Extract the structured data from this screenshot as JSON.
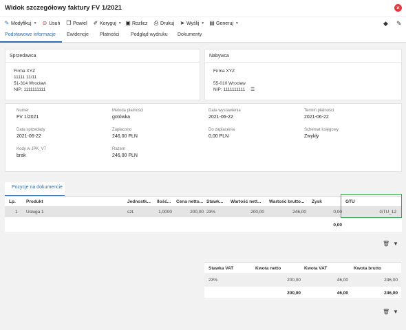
{
  "window": {
    "title": "Widok szczegółowy faktury FV 1/2021",
    "close_icon": "close-icon"
  },
  "toolbar": {
    "modify": "Modyfikuj",
    "delete": "Usuń",
    "duplicate": "Powiel",
    "correct": "Koryguj",
    "settle": "Rozlicz",
    "print": "Drukuj",
    "send": "Wyślij",
    "generate": "Generuj"
  },
  "tabs": [
    "Podstawowe informacje",
    "Ewidencje",
    "Płatności",
    "Podgląd wydruku",
    "Dokumenty"
  ],
  "seller": {
    "header": "Sprzedawca",
    "lines": [
      "Firma XYZ",
      "11111 11/11",
      "51-314 Wrocław",
      "NIP: 1111111111"
    ]
  },
  "buyer": {
    "header": "Nabywca",
    "lines": [
      "Firma XYZ",
      "",
      "55-010 Wrocław",
      "NIP: 1111111111"
    ]
  },
  "details": {
    "number_label": "Numer",
    "number": "FV 1/2021",
    "payment_method_label": "Metoda płatności",
    "payment_method": "gotówka",
    "issue_date_label": "Data wystawienia",
    "issue_date": "2021-06-22",
    "due_date_label": "Termin płatności",
    "due_date": "2021-06-22",
    "sale_date_label": "Data sprzedaży",
    "sale_date": "2021-06-22",
    "paid_label": "Zapłacono",
    "paid": "246,00 PLN",
    "to_pay_label": "Do zapłacenia",
    "to_pay": "0,00 PLN",
    "scheme_label": "Schemat księgowy",
    "scheme": "Zwykły",
    "jpk_label": "Kody w JPK_V7",
    "jpk": "brak",
    "total_label": "Razem",
    "total": "246,00 PLN"
  },
  "items": {
    "section_tab": "Pozycje na dokumencie",
    "headers": [
      "Lp.",
      "Produkt",
      "Jednostk...",
      "Ilość...",
      "Cena netto...",
      "Stawk...",
      "Wartość nett...",
      "Wartość brutto...",
      "Zysk",
      "GTU"
    ],
    "rows": [
      [
        "1",
        "Usługa 1",
        "szt.",
        "1,0000",
        "200,00",
        "23%",
        "200,00",
        "246,00",
        "0,00",
        "GTU_12"
      ]
    ],
    "footer_profit": "0,00"
  },
  "vat": {
    "headers": [
      "Stawka VAT",
      "Kwota netto",
      "Kwota VAT",
      "Kwota brutto"
    ],
    "rows": [
      [
        "23%",
        "200,00",
        "46,00",
        "246,00"
      ]
    ],
    "totals": [
      "",
      "200,00",
      "46,00",
      "246,00"
    ]
  }
}
